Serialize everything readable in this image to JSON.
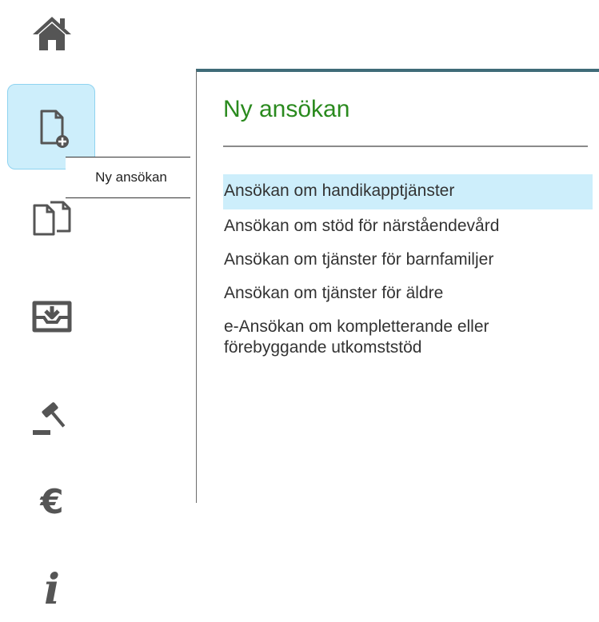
{
  "sidebar": {
    "items": [
      {
        "icon": "home-icon"
      },
      {
        "icon": "new-application-icon"
      },
      {
        "icon": "documents-icon"
      },
      {
        "icon": "inbox-icon"
      },
      {
        "icon": "decision-gavel-icon"
      },
      {
        "icon": "euro-icon"
      },
      {
        "icon": "info-icon"
      }
    ],
    "tooltip": "Ny ansökan"
  },
  "panel": {
    "title": "Ny ansökan",
    "items": [
      {
        "label": "Ansökan om handikapptjänster",
        "active": true
      },
      {
        "label": "Ansökan om stöd för närståendevård",
        "active": false
      },
      {
        "label": "Ansökan om tjänster för barnfamiljer",
        "active": false
      },
      {
        "label": "Ansökan om tjänster för äldre",
        "active": false
      },
      {
        "label": "e-Ansökan om kompletterande eller förebyggande utkomststöd",
        "active": false
      }
    ]
  },
  "colors": {
    "accent_bg": "#cdeefb",
    "title": "#2a8a1e",
    "icon": "#555555",
    "panel_top_border": "#3f6b78"
  }
}
